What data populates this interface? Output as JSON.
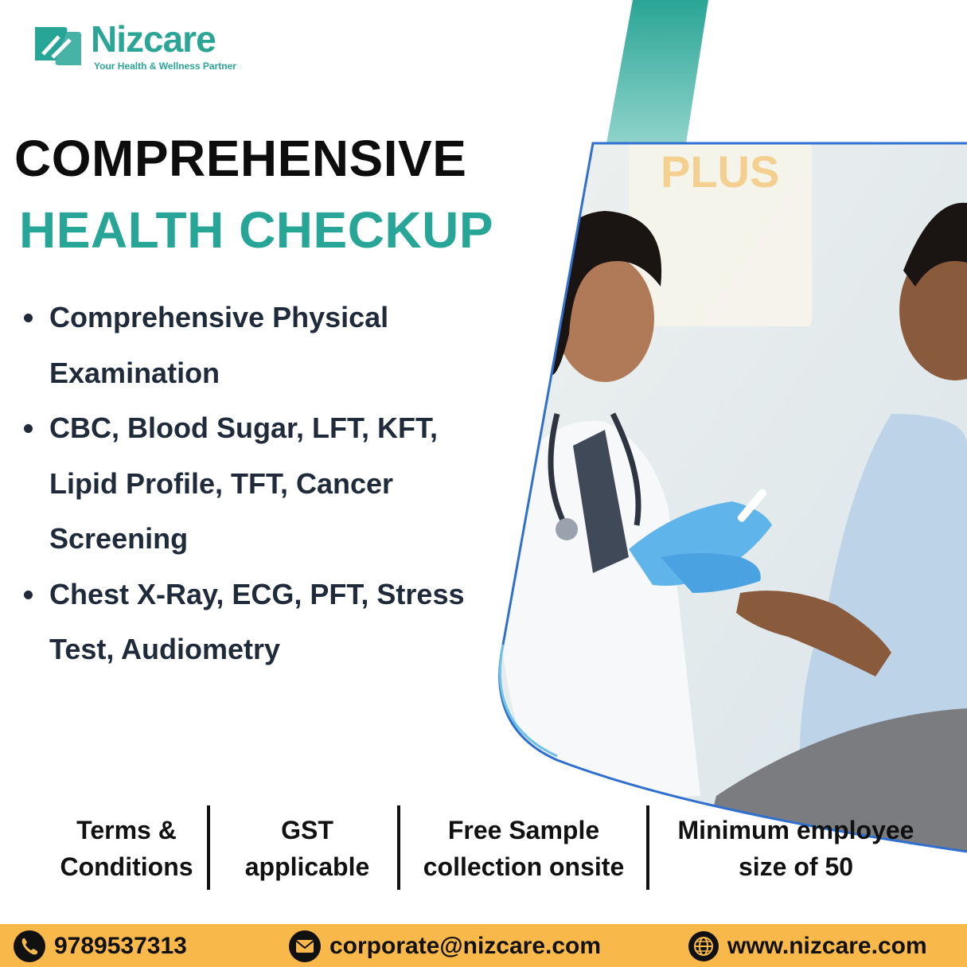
{
  "brand": {
    "name": "Nizcare",
    "tagline": "Your Health & Wellness Partner"
  },
  "headline": {
    "line1": "COMPREHENSIVE",
    "line2": "HEALTH CHECKUP"
  },
  "features": [
    "Comprehensive Physical Examination",
    "CBC, Blood Sugar, LFT, KFT, Lipid Profile, TFT, Cancer Screening",
    "Chest X-Ray, ECG, PFT, Stress Test, Audiometry"
  ],
  "terms": [
    {
      "line1": "Terms &",
      "line2": "Conditions"
    },
    {
      "line1": "GST",
      "line2": "applicable"
    },
    {
      "line1": "Free Sample",
      "line2": "collection onsite"
    },
    {
      "line1": "Minimum employee",
      "line2": "size of 50"
    }
  ],
  "contact": {
    "phone": "9789537313",
    "email": "corporate@nizcare.com",
    "website": "www.nizcare.com"
  },
  "colors": {
    "brand_teal": "#27a596",
    "footer_orange": "#f9b84a",
    "text_dark": "#1f2a3a",
    "photo_border": "#2f6fd0"
  },
  "icons": [
    "phone-icon",
    "mail-icon",
    "globe-icon"
  ]
}
